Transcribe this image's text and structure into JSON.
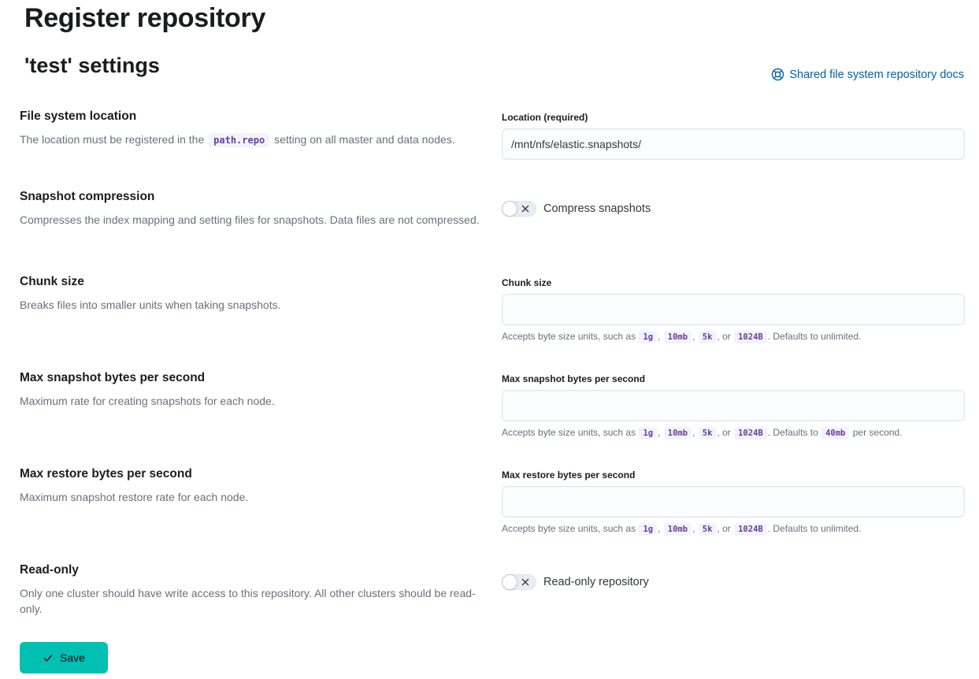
{
  "header": {
    "title": "Register repository",
    "subtitle": "'test' settings",
    "docs_link": "Shared file system repository docs"
  },
  "location": {
    "title": "File system location",
    "desc_before": "The location must be registered in the",
    "desc_code": "path.repo",
    "desc_after": "setting on all master and data nodes.",
    "label": "Location (required)",
    "value": "/mnt/nfs/elastic.snapshots/"
  },
  "compression": {
    "title": "Snapshot compression",
    "desc": "Compresses the index mapping and setting files for snapshots. Data files are not compressed.",
    "toggle_label": "Compress snapshots",
    "checked": false
  },
  "chunk": {
    "title": "Chunk size",
    "desc": "Breaks files into smaller units when taking snapshots.",
    "label": "Chunk size",
    "value": "",
    "help_prefix": "Accepts byte size units, such as",
    "units": [
      "1g",
      "10mb",
      "5k",
      "1024B"
    ],
    "sep": ",",
    "or": ", or",
    "help_suffix": ". Defaults to unlimited."
  },
  "max_snapshot": {
    "title": "Max snapshot bytes per second",
    "desc": "Maximum rate for creating snapshots for each node.",
    "label": "Max snapshot bytes per second",
    "value": "",
    "help_prefix": "Accepts byte size units, such as",
    "units": [
      "1g",
      "10mb",
      "5k",
      "1024B"
    ],
    "sep": ",",
    "or": ", or",
    "help_mid": ". Defaults to",
    "default_code": "40mb",
    "help_suffix": "per second."
  },
  "max_restore": {
    "title": "Max restore bytes per second",
    "desc": "Maximum snapshot restore rate for each node.",
    "label": "Max restore bytes per second",
    "value": "",
    "help_prefix": "Accepts byte size units, such as",
    "units": [
      "1g",
      "10mb",
      "5k",
      "1024B"
    ],
    "sep": ",",
    "or": ", or",
    "help_suffix": ". Defaults to unlimited."
  },
  "readonly": {
    "title": "Read-only",
    "desc": "Only one cluster should have write access to this repository. All other clusters should be read-only.",
    "toggle_label": "Read-only repository",
    "checked": false
  },
  "footer": {
    "save_label": "Save"
  },
  "colors": {
    "accent": "#00bfb3",
    "link": "#0061a6",
    "code_text": "#6b3c9f"
  }
}
